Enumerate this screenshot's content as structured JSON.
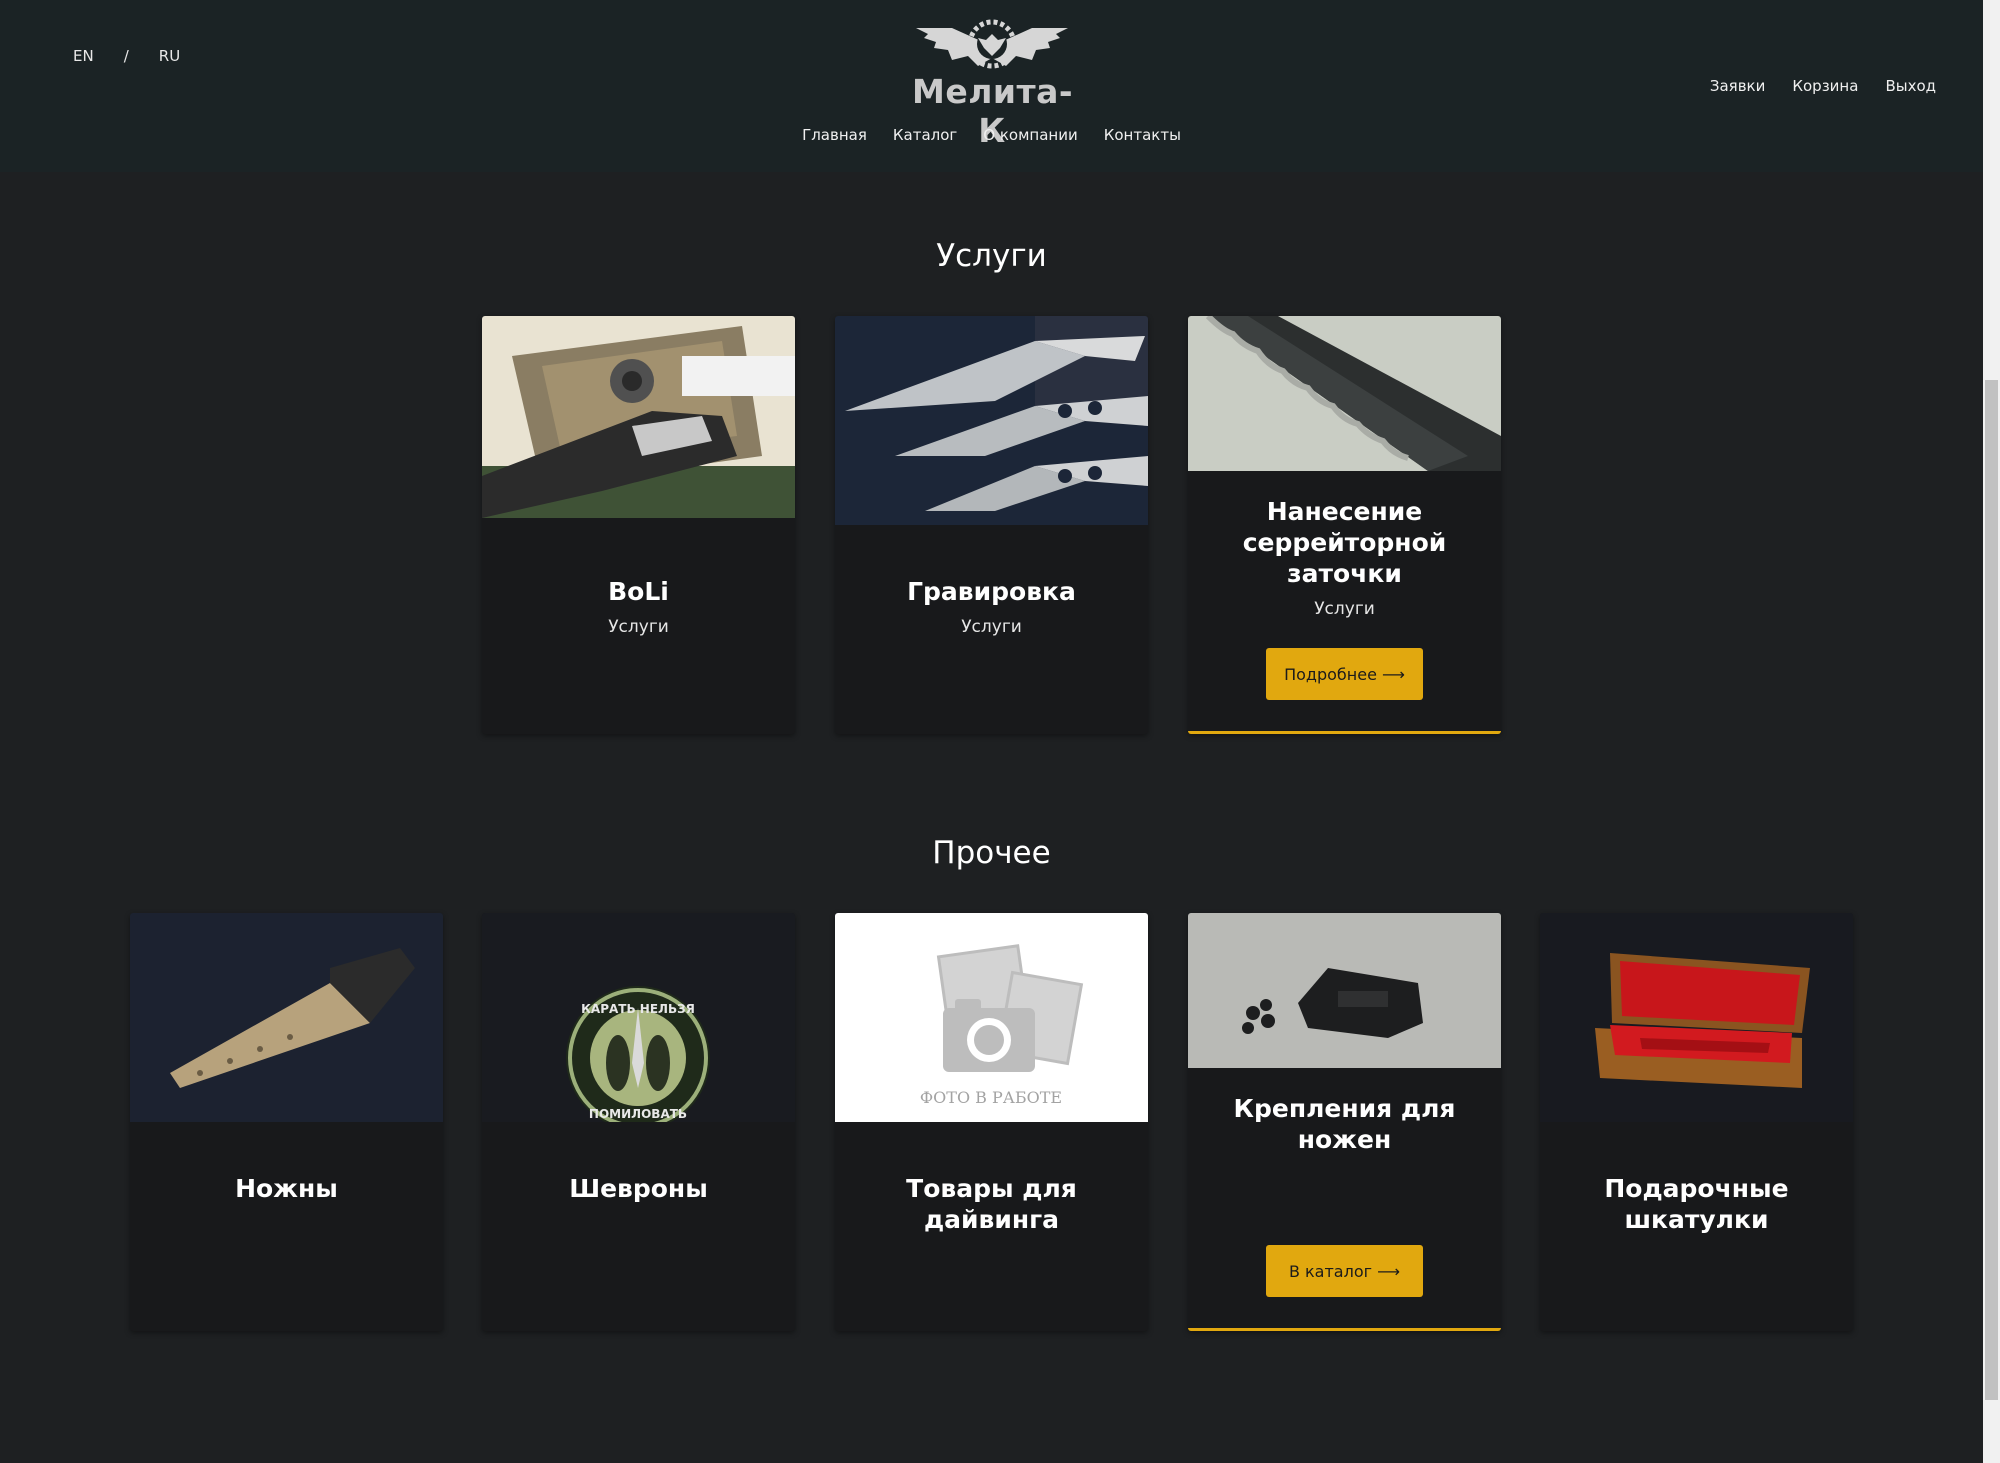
{
  "header": {
    "lang_en": "EN",
    "lang_sep": "/",
    "lang_ru": "RU",
    "logo_text": "Мелита-К",
    "nav": [
      "Главная",
      "Каталог",
      "О компании",
      "Контакты"
    ],
    "user_nav": [
      "Заявки",
      "Корзина",
      "Выход"
    ]
  },
  "services": {
    "title": "Услуги",
    "cards": [
      {
        "title": "BoLi",
        "subtitle": "Услуги"
      },
      {
        "title": "Гравировка",
        "subtitle": "Услуги"
      },
      {
        "title": "Нанесение серрейторной заточки",
        "subtitle": "Услуги",
        "button": "Подробнее ⟶"
      }
    ]
  },
  "other": {
    "title": "Прочее",
    "cards": [
      {
        "title": "Ножны"
      },
      {
        "title": "Шевроны"
      },
      {
        "title": "Товары для дайвинга",
        "placeholder_text": "ФОТО В РАБОТЕ"
      },
      {
        "title": "Крепления для ножен",
        "button": "В каталог ⟶"
      },
      {
        "title": "Подарочные шкатулки"
      }
    ],
    "patch_text_top": "КАРАТЬ НЕЛЬЗЯ",
    "patch_text_bottom": "ПОМИЛОВАТЬ"
  },
  "colors": {
    "accent": "#e1a80f",
    "header_bg": "#1b2325",
    "page_bg": "#1e2022",
    "card_bg": "#18191b"
  }
}
